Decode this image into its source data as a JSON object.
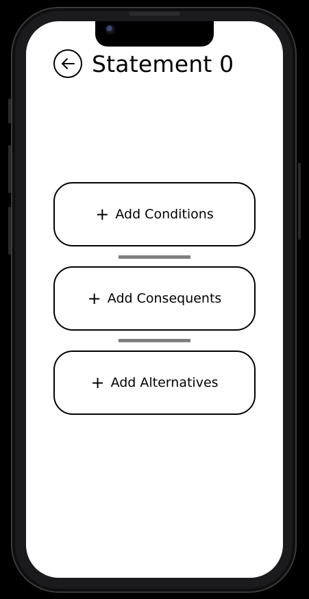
{
  "screen": {
    "title": "Statement 0",
    "back_icon": "arrow-left-icon"
  },
  "actions": [
    {
      "label": "Add Conditions",
      "icon": "plus-icon"
    },
    {
      "label": "Add Consequents",
      "icon": "plus-icon"
    },
    {
      "label": "Add Alternatives",
      "icon": "plus-icon"
    }
  ],
  "colors": {
    "background": "#ffffff",
    "border": "#000000",
    "connector": "#7f7f7f",
    "device_frame": "#1b1b1d"
  }
}
